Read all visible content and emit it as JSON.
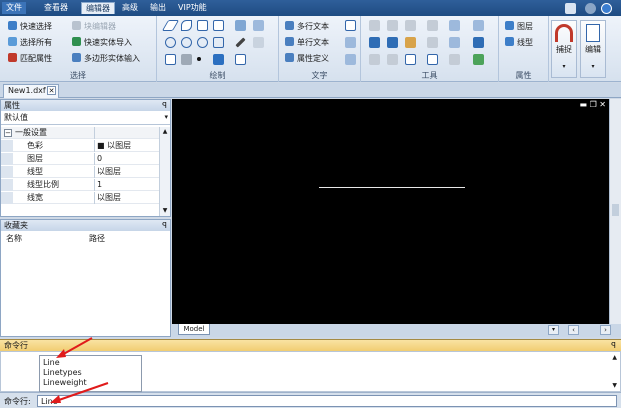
{
  "menubar": {
    "items": [
      "文件",
      "查看器",
      "编辑器",
      "高级",
      "输出",
      "VIP功能"
    ],
    "active_index": 2
  },
  "ribbon": {
    "select_group": {
      "label": "选择",
      "buttons": [
        "快速选择",
        "选择所有",
        "匹配属性",
        "块编辑器",
        "快速实体导入",
        "多边形实体输入"
      ]
    },
    "draw_group": {
      "label": "绘制"
    },
    "text_group": {
      "label": "文字",
      "buttons": [
        "多行文本",
        "单行文本",
        "属性定义"
      ]
    },
    "tools_group": {
      "label": "工具"
    },
    "props_group": {
      "label": "属性",
      "buttons": [
        "图层",
        "线型"
      ]
    },
    "snap_label": "捕捉",
    "edit_label": "编辑"
  },
  "document_tab": {
    "title": "New1.dxf"
  },
  "properties_panel": {
    "title": "属性",
    "filter_value": "默认值",
    "section": "一般设置",
    "rows": [
      {
        "key": "色彩",
        "value": "■ 以图层"
      },
      {
        "key": "图层",
        "value": "0"
      },
      {
        "key": "线型",
        "value": "以图层"
      },
      {
        "key": "线型比例",
        "value": "1"
      },
      {
        "key": "线宽",
        "value": "以图层"
      }
    ]
  },
  "favorites_panel": {
    "title": "收藏夹",
    "columns": [
      "名称",
      "路径"
    ]
  },
  "canvas": {
    "model_tab": "Model",
    "background": "#000000",
    "line_color": "#e8e8e8"
  },
  "command": {
    "header": "命令行",
    "suggestions": [
      "Line",
      "Linetypes",
      "Lineweight"
    ],
    "input_label": "命令行:",
    "input_value": "Line"
  },
  "colors": {
    "menubar": "#1e4b82",
    "ribbon": "#dbe5f1",
    "command_header": "#f1cd72",
    "arrow": "#e01b1b"
  }
}
